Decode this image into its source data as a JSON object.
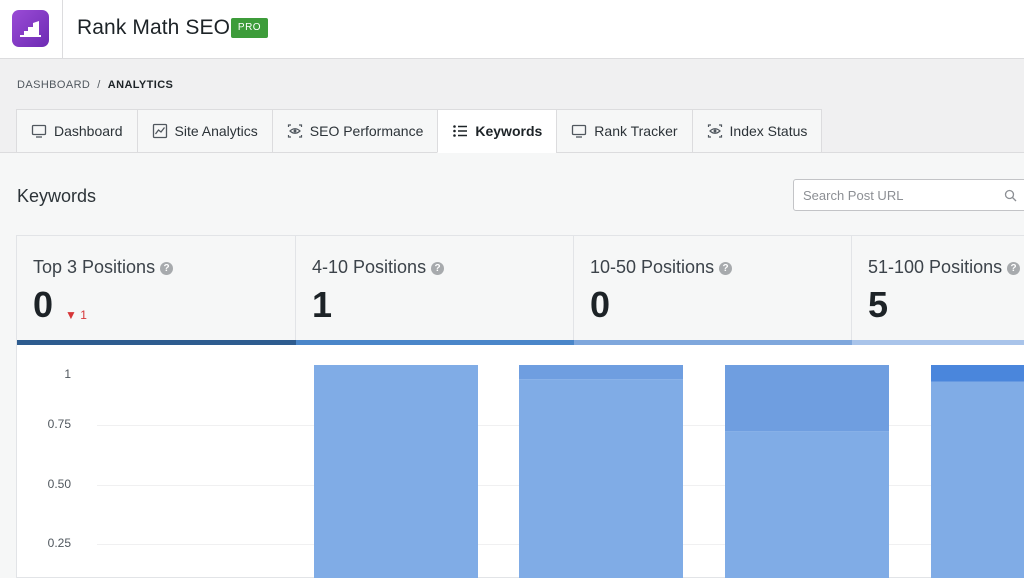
{
  "app": {
    "title": "Rank Math SEO",
    "badge": "PRO",
    "logo_icon": "rank-math-logo-icon"
  },
  "breadcrumb": {
    "root": "DASHBOARD",
    "separator": "/",
    "current": "ANALYTICS"
  },
  "tabs": [
    {
      "label": "Dashboard",
      "icon": "monitor-icon",
      "active": false
    },
    {
      "label": "Site Analytics",
      "icon": "line-chart-icon",
      "active": false
    },
    {
      "label": "SEO Performance",
      "icon": "eye-icon",
      "active": false
    },
    {
      "label": "Keywords",
      "icon": "list-icon",
      "active": true
    },
    {
      "label": "Rank Tracker",
      "icon": "monitor-icon",
      "active": false
    },
    {
      "label": "Index Status",
      "icon": "eye-icon",
      "active": false
    }
  ],
  "section": {
    "title": "Keywords"
  },
  "search": {
    "placeholder": "Search Post URL",
    "icon": "search-icon"
  },
  "stats": [
    {
      "label": "Top 3 Positions",
      "value": "0",
      "delta": "1",
      "delta_direction": "down",
      "bar_color": "#2e5c8f"
    },
    {
      "label": "4-10 Positions",
      "value": "1",
      "bar_color": "#4a86c9"
    },
    {
      "label": "10-50 Positions",
      "value": "0",
      "bar_color": "#7fa7dc"
    },
    {
      "label": "51-100 Positions",
      "value": "5",
      "bar_color": "#a9c4ea"
    }
  ],
  "colors": {
    "bar": "#80ace6",
    "bar_dark": "#6f9ee0",
    "bar_darkest": "#4a86dc",
    "pro_badge": "#3d9c3a",
    "delta_down": "#d63638"
  },
  "chart_data": {
    "type": "bar",
    "stacked": true,
    "yticks": [
      "1",
      "0.75",
      "0.50",
      "0.25"
    ],
    "ylim": [
      0,
      1
    ],
    "grid": true,
    "series": [
      {
        "values": [
          1,
          0.94,
          0.72,
          0.93
        ]
      },
      {
        "values": [
          0,
          0.06,
          0.28,
          0
        ]
      },
      {
        "values": [
          0,
          0,
          0,
          0.07
        ]
      }
    ]
  }
}
